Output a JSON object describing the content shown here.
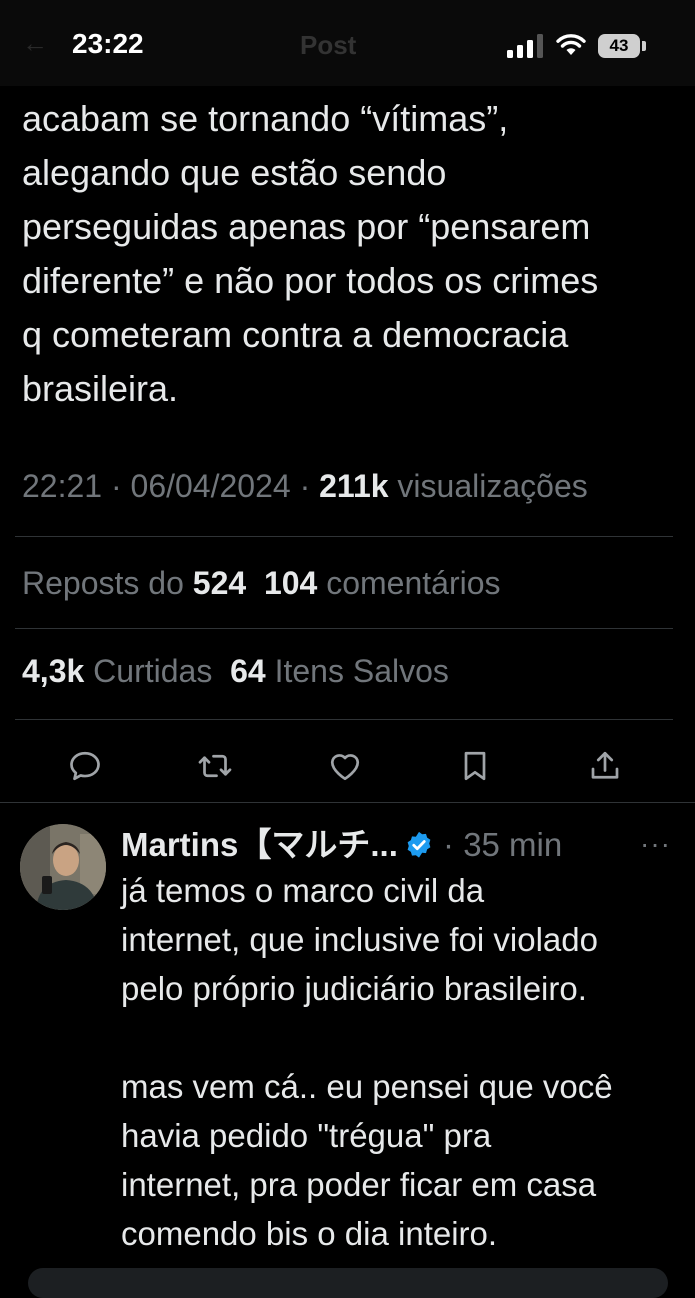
{
  "status_bar": {
    "time": "23:22",
    "battery": "43",
    "ghost_title": "Post",
    "ghost_back": "←"
  },
  "tweet": {
    "text_lines": [
      "acabam se tornando “vítimas”,",
      "alegando que estão sendo",
      "perseguidas apenas por “pensarem",
      "diferente” e não por todos os crimes",
      "q cometeram contra a democracia",
      "brasileira."
    ],
    "time": "22:21",
    "date": "06/04/2024",
    "views_count": "211k",
    "views_label": "visualizações",
    "reposts_label": "Reposts do",
    "reposts_count": "524",
    "comments_count": "104",
    "comments_label": "comentários",
    "likes_count": "4,3k",
    "likes_label": "Curtidas",
    "saves_count": "64",
    "saves_label": "Itens Salvos"
  },
  "actions": [
    {
      "icon": "reply-icon"
    },
    {
      "icon": "repost-icon"
    },
    {
      "icon": "like-icon"
    },
    {
      "icon": "bookmark-icon"
    },
    {
      "icon": "share-icon"
    }
  ],
  "reply": {
    "name": "Martins【マルチ...",
    "time": "35 min",
    "more": "···",
    "text_lines": [
      "já temos o marco civil da",
      "internet, que inclusive foi violado",
      "pelo próprio judiciário brasileiro.",
      "",
      "mas vem cá.. eu pensei que você",
      "havia pedido \"trégua\" pra",
      "internet, pra poder ficar em casa",
      "comendo bis o dia inteiro."
    ]
  },
  "colors": {
    "background": "#000000",
    "text": "#e7e9ea",
    "muted": "#71767b",
    "divider": "#2f3336",
    "verified": "#1d9bf0"
  }
}
